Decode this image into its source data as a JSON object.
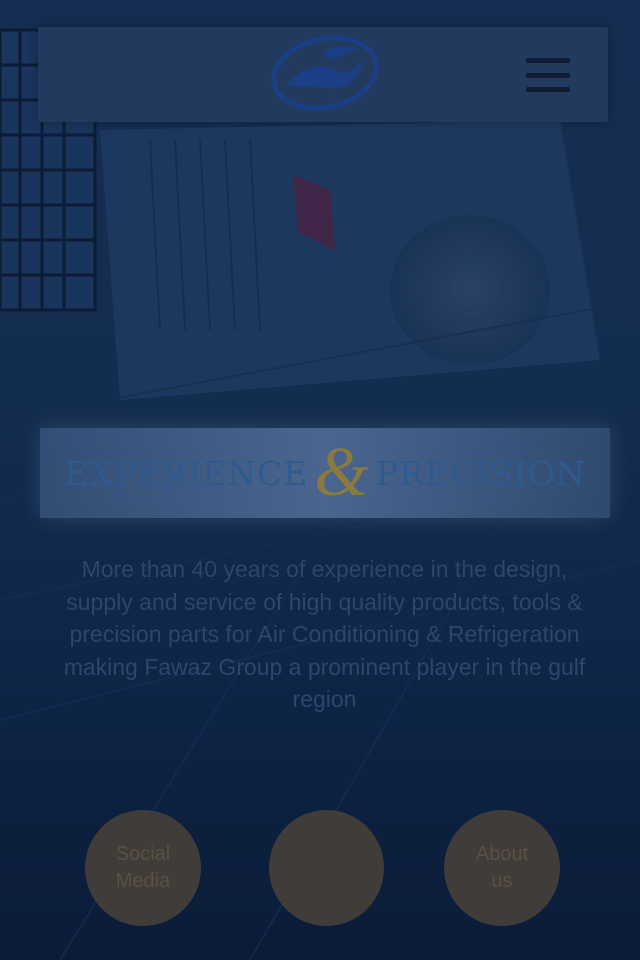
{
  "header": {
    "logo_icon": "fawaz-group-logo-icon",
    "menu_icon": "hamburger-menu-icon"
  },
  "banner": {
    "word_left": "EXPERIENCE",
    "ampersand": "&",
    "word_right": "PRECISION"
  },
  "intro": {
    "text": "More than 40 years of experience in the design, supply and service of high quality products, tools & precision parts for Air Conditioning & Refrigeration making Fawaz Group a prominent player in the gulf region"
  },
  "actions": {
    "social_line1": "Social",
    "social_line2": "Media",
    "middle_label": "",
    "about_line1": "About",
    "about_line2": "us"
  },
  "colors": {
    "overlay": "#0c1f3d",
    "header_bg": "#223a5e",
    "banner_text": "#2f5a8f",
    "ampersand": "#8a7a3e",
    "circle_bg": "#403c39",
    "circle_text": "#5a5043"
  }
}
